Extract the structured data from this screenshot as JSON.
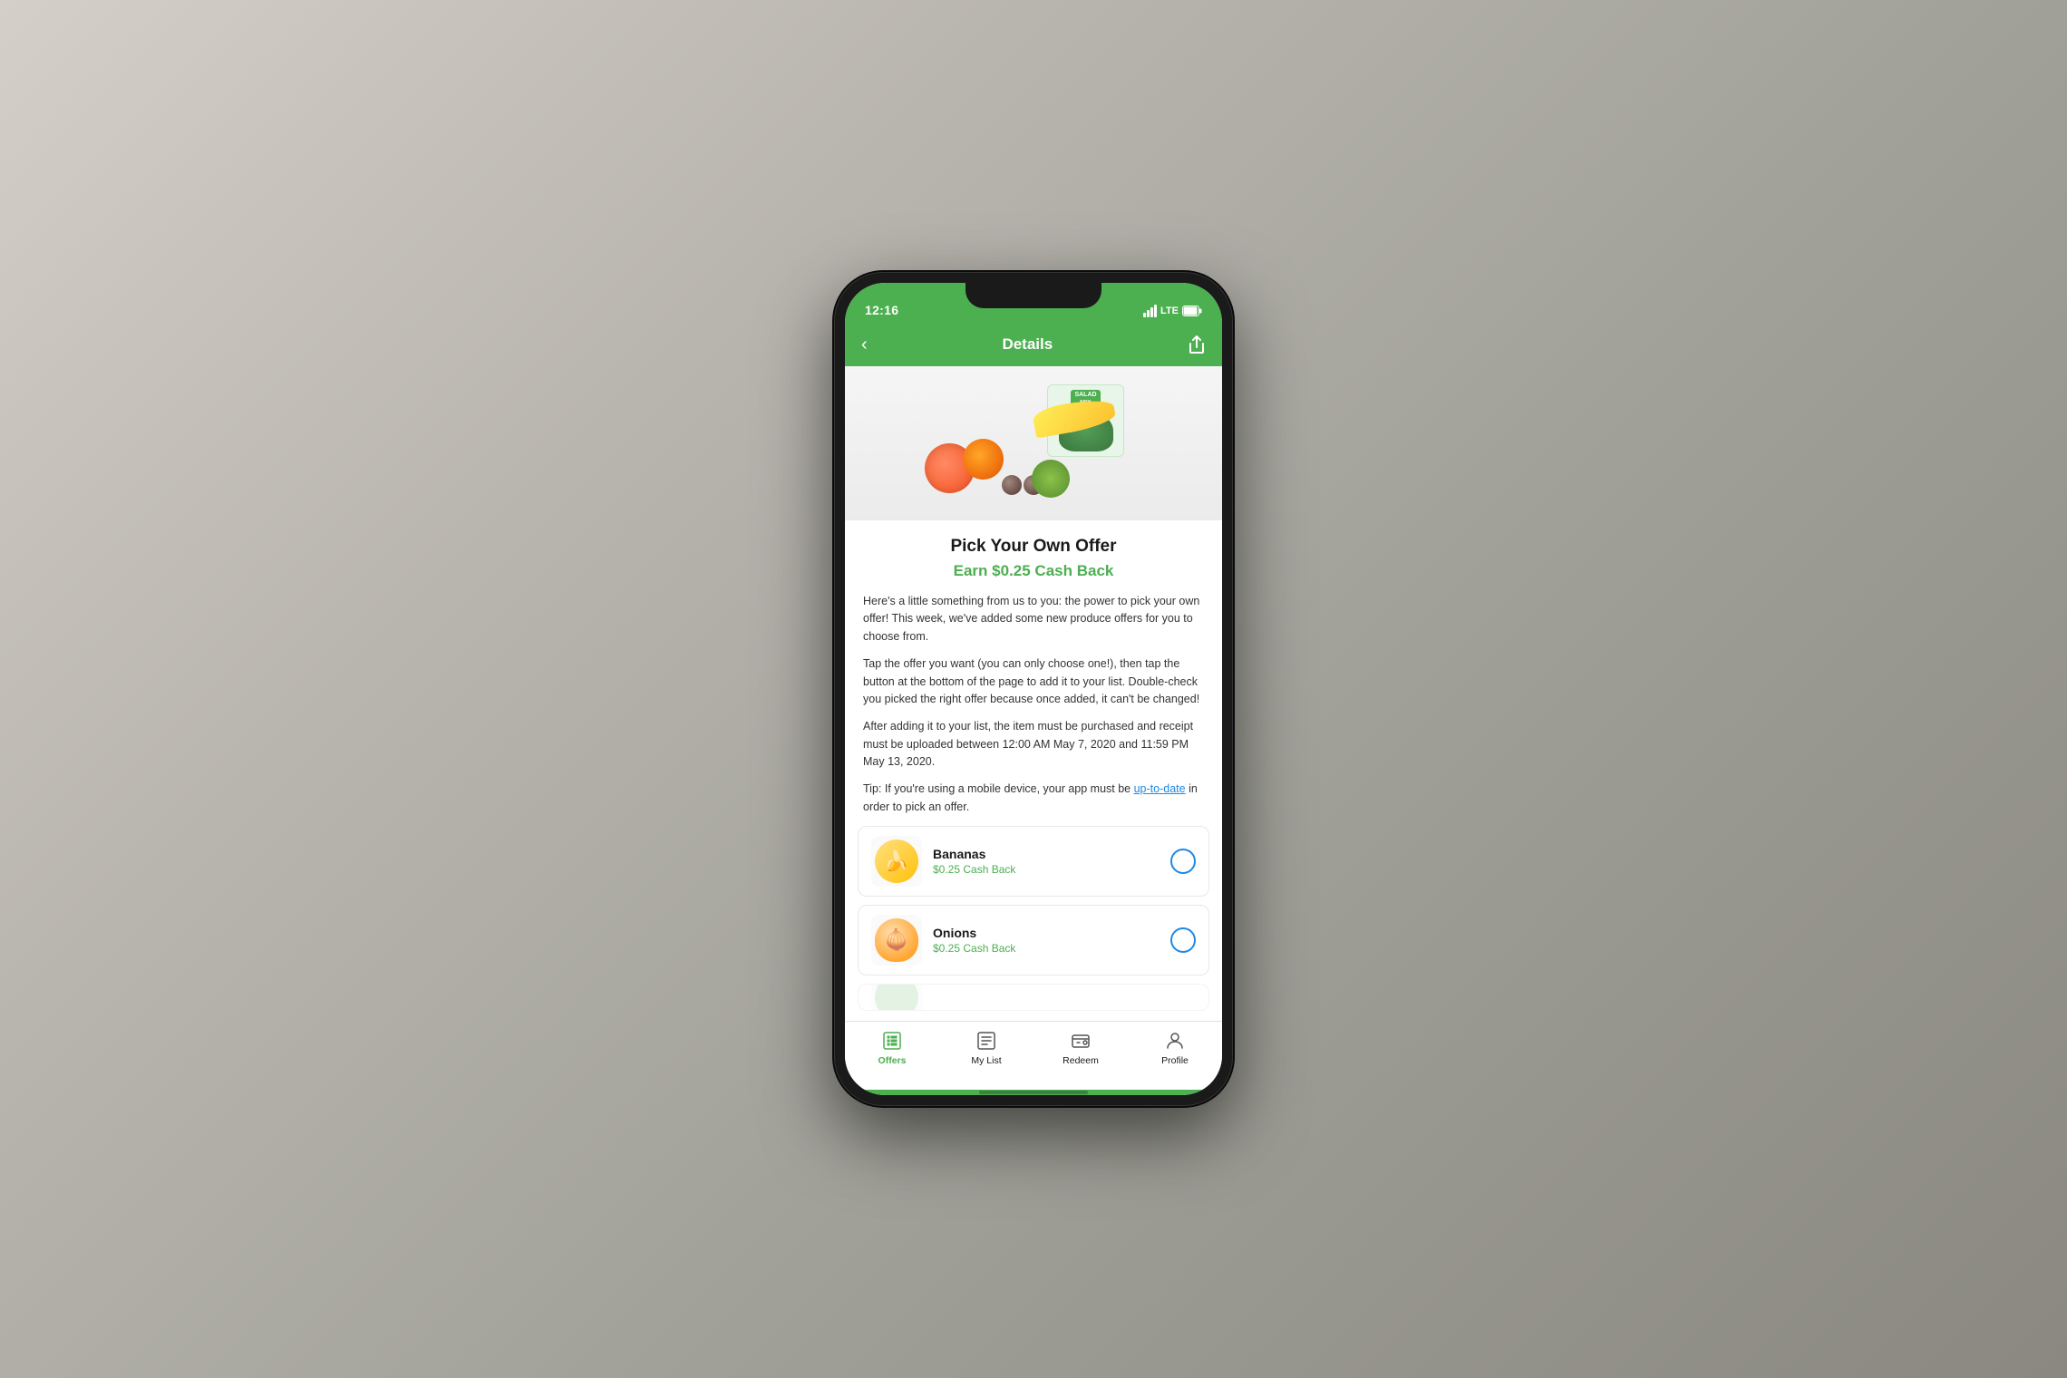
{
  "status_bar": {
    "time": "12:16",
    "signal_label": "LTE",
    "battery_icon": "battery-icon",
    "location_icon": "location-icon"
  },
  "nav": {
    "back_label": "‹",
    "title": "Details",
    "share_icon": "share-icon"
  },
  "offer": {
    "title": "Pick Your Own Offer",
    "cashback": "Earn $0.25 Cash Back",
    "description_1": "Here's a little something from us to you: the power to pick your own offer! This week, we've added some new produce offers for you to choose from.",
    "description_2": "Tap the offer you want (you can only choose one!), then tap the button at the bottom of the page to add it to your list. Double-check you picked the right offer because once added, it can't be changed!",
    "description_3": "After adding it to your list, the item must be purchased and receipt must be uploaded between 12:00 AM May 7, 2020 and 11:59 PM May 13, 2020.",
    "tip_text": "Tip: If you're using a mobile device, your app must be ",
    "tip_link": "up-to-date",
    "tip_suffix": " in order to pick an offer."
  },
  "products": [
    {
      "name": "Bananas",
      "cashback": "$0.25 Cash Back",
      "emoji": "🍌",
      "selected": false
    },
    {
      "name": "Onions",
      "cashback": "$0.25 Cash Back",
      "emoji": "🧅",
      "selected": false
    }
  ],
  "tabs": [
    {
      "label": "Offers",
      "icon": "offers-icon",
      "active": true
    },
    {
      "label": "My List",
      "icon": "my-list-icon",
      "active": false
    },
    {
      "label": "Redeem",
      "icon": "redeem-icon",
      "active": false
    },
    {
      "label": "Profile",
      "icon": "profile-icon",
      "active": false
    }
  ],
  "colors": {
    "brand_green": "#4caf50",
    "link_blue": "#1e88e5",
    "text_dark": "#1a1a1a",
    "text_mid": "#333333",
    "border": "#e0e0e0"
  }
}
